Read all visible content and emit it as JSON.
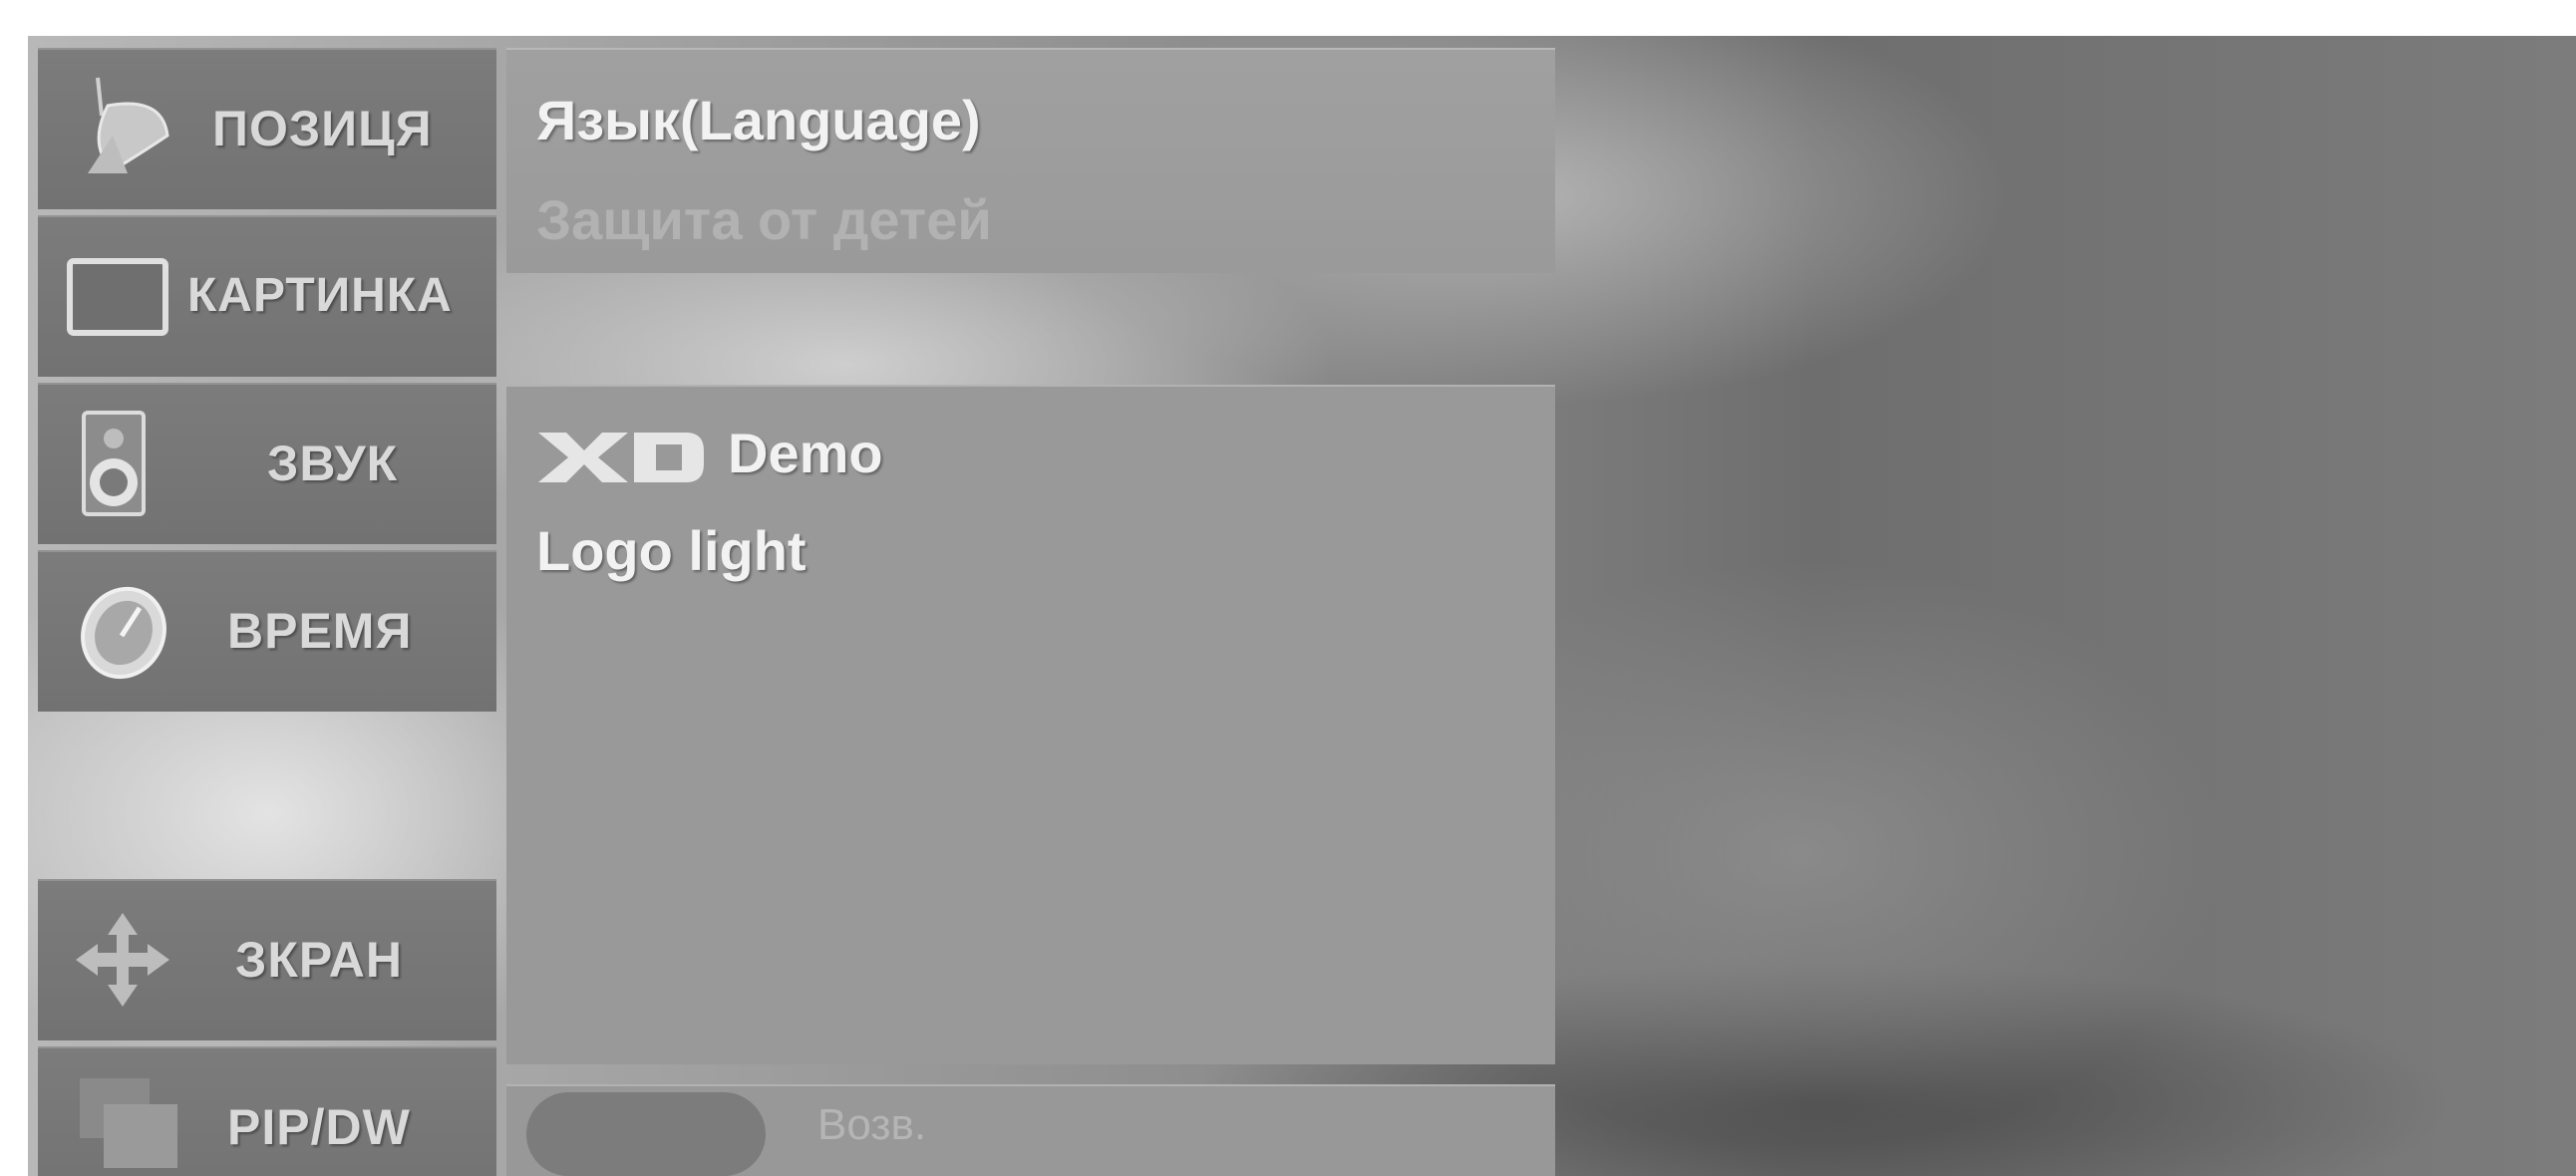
{
  "sidebar": {
    "items": [
      {
        "label": "ПОЗИЦЯ",
        "icon": "satellite-dish-icon"
      },
      {
        "label": "КАРТИНКА",
        "icon": "screen-icon"
      },
      {
        "label": "ЗВУК",
        "icon": "speaker-icon"
      },
      {
        "label": "ВРЕМЯ",
        "icon": "clock-icon"
      },
      {
        "label": "ЗКРАН",
        "icon": "move-arrows-icon"
      },
      {
        "label": "PIP/DW",
        "icon": "pip-icon"
      }
    ]
  },
  "main": {
    "top_menu": [
      "Язык(Language)",
      "Защита от детей"
    ],
    "demo": {
      "logo": "XD",
      "label": "Demo"
    },
    "logo_light": "Logo light"
  },
  "footer": {
    "back_label": "Возв."
  }
}
